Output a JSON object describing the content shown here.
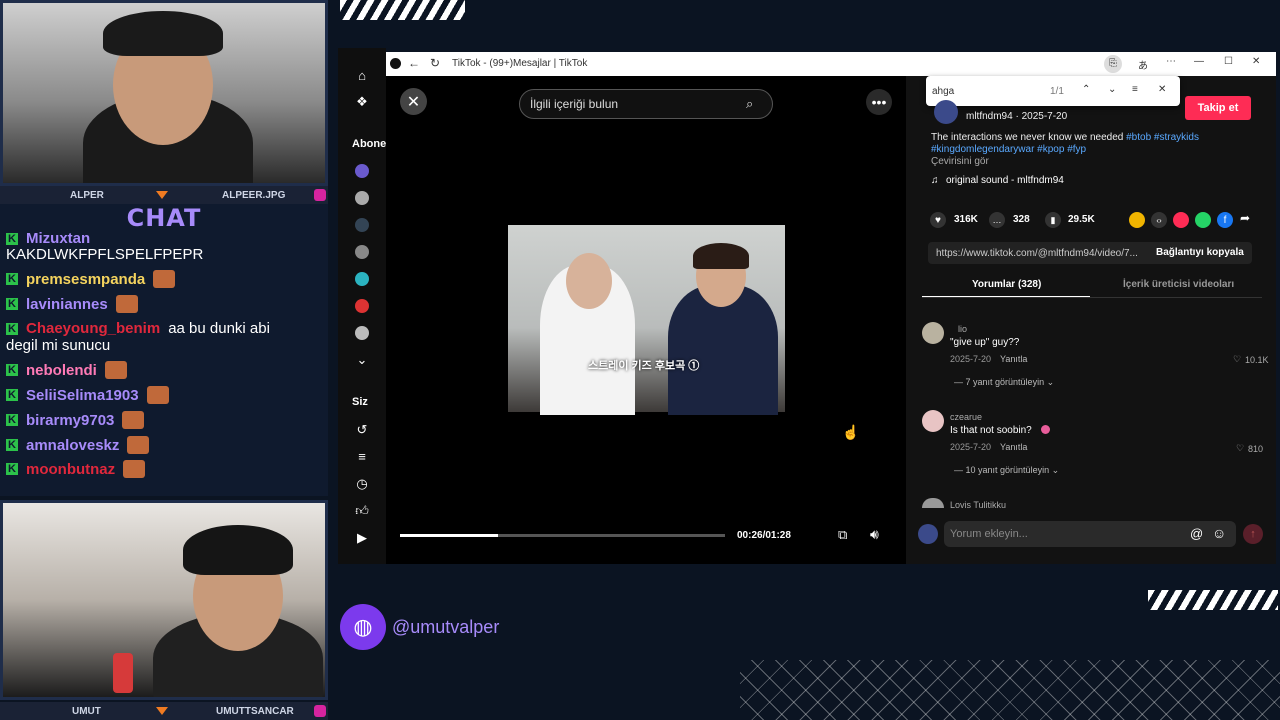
{
  "overlay": {
    "cam1_name_left": "ALPER",
    "cam1_name_right": "ALPEER.JPG",
    "cam2_name_left": "UMUT",
    "cam2_name_right": "UMUTTSANCAR",
    "chat_title": "CHAT",
    "handle": "@umutvalper",
    "chat": [
      {
        "user": "Mizuxtan",
        "color": "#a78bfa",
        "msg": ""
      },
      {
        "user": "",
        "color": "#ffffff",
        "msg": "KAKDLWKFPFLSPELFPEPR"
      },
      {
        "user": "premsesmpanda",
        "color": "#f4d35e",
        "msg": ""
      },
      {
        "user": "laviniannes",
        "color": "#a78bfa",
        "msg": ""
      },
      {
        "user": "Chaeyoung_benim",
        "color": "#e0283c",
        "msg": "aa bu dunki abi"
      },
      {
        "user": "",
        "color": "#ffffff",
        "msg": "degil mi sunucu"
      },
      {
        "user": "nebolendi",
        "color": "#ff7ab6",
        "msg": ""
      },
      {
        "user": "SeliiSelima1903",
        "color": "#a78bfa",
        "msg": ""
      },
      {
        "user": "birarmy9703",
        "color": "#a78bfa",
        "msg": ""
      },
      {
        "user": "amnaloveskz",
        "color": "#a78bfa",
        "msg": ""
      },
      {
        "user": "moonbutnaz",
        "color": "#e0283c",
        "msg": ""
      }
    ]
  },
  "youtube": {
    "subs_label": "Abonel",
    "you_label": "Siz"
  },
  "browser": {
    "title": "TikTok - (99+)Mesajlar | TikTok",
    "find_query": "ahga",
    "find_count": "1/1"
  },
  "video": {
    "search_placeholder": "İlgili içeriği bulun",
    "caption": "스트레이 키즈 후보곡 ①",
    "time": "00:26/01:28",
    "progress": 0.3
  },
  "post": {
    "author": "mltfndm94 · 2025-7-20",
    "follow": "Takip et",
    "desc": "The interactions we never know we needed",
    "hashtags": "#btob #straykids",
    "hashtags2": "#kingdomlegendarywar #kpop #fyp",
    "translate": "Çevirisini gör",
    "sound": "original sound - mltfndm94",
    "likes": "316K",
    "comments": "328",
    "saves": "29.5K",
    "url": "https://www.tiktok.com/@mltfndm94/video/7...",
    "copy_link": "Bağlantıyı kopyala",
    "tab_comments": "Yorumlar (328)",
    "tab_creator": "İçerik üreticisi videoları",
    "comment_placeholder": "Yorum ekleyin..."
  },
  "comments": [
    {
      "user": "lio",
      "text": "\"give up\" guy??",
      "date": "2025-7-20",
      "reply": "Yanıtla",
      "likes": "10.1K",
      "more": "7 yanıt görüntüleyin"
    },
    {
      "user": "czearue",
      "text": "Is that not soobin?",
      "date": "2025-7-20",
      "reply": "Yanıtla",
      "likes": "810",
      "more": "10 yanıt görüntüleyin"
    },
    {
      "user": "Lovis Tulitikku",
      "text": "",
      "date": "",
      "reply": "",
      "likes": "",
      "more": ""
    }
  ]
}
